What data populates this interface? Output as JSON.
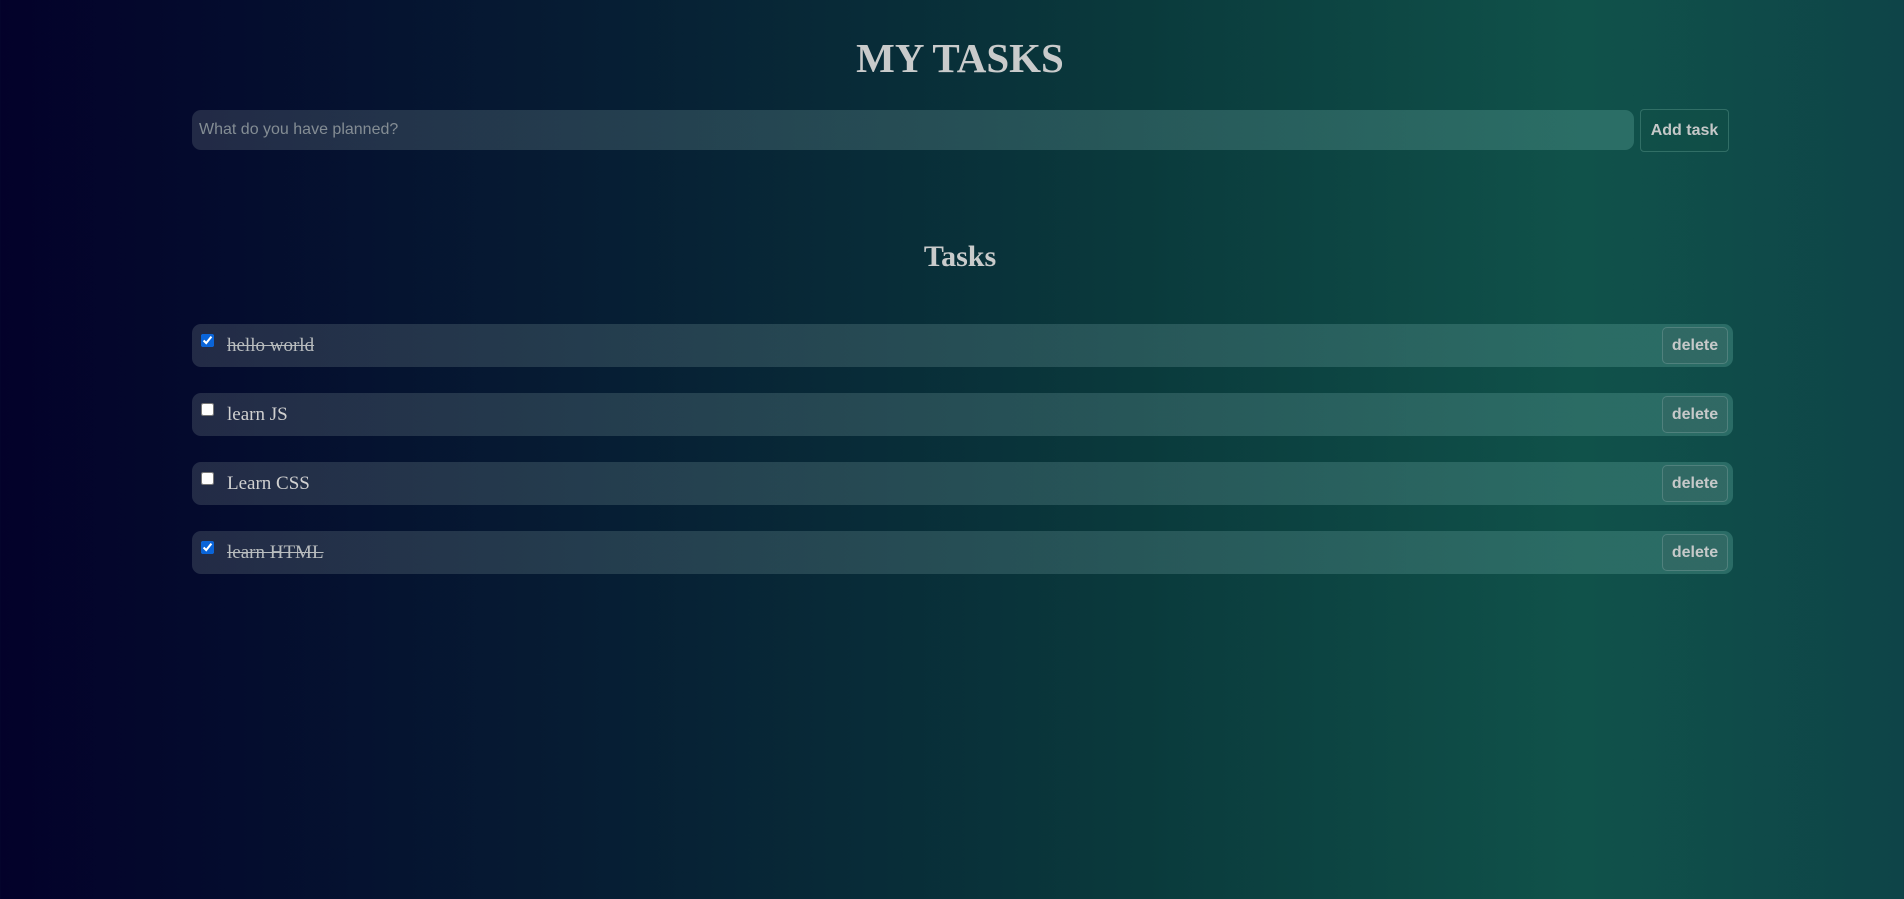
{
  "header": {
    "title": "MY TASKS"
  },
  "new_task": {
    "placeholder": "What do you have planned?",
    "value": "",
    "add_label": "Add task"
  },
  "list": {
    "title": "Tasks",
    "delete_label": "delete",
    "items": [
      {
        "text": "hello world",
        "done": true
      },
      {
        "text": "learn JS",
        "done": false
      },
      {
        "text": "Learn CSS",
        "done": false
      },
      {
        "text": "learn HTML",
        "done": true
      }
    ]
  },
  "colors": {
    "gradient_start": "#03012a",
    "gradient_mid": "#0a3a3c",
    "gradient_end": "#10524a",
    "checkbox_accent": "#0a64d8",
    "text": "#c7c7c7"
  }
}
